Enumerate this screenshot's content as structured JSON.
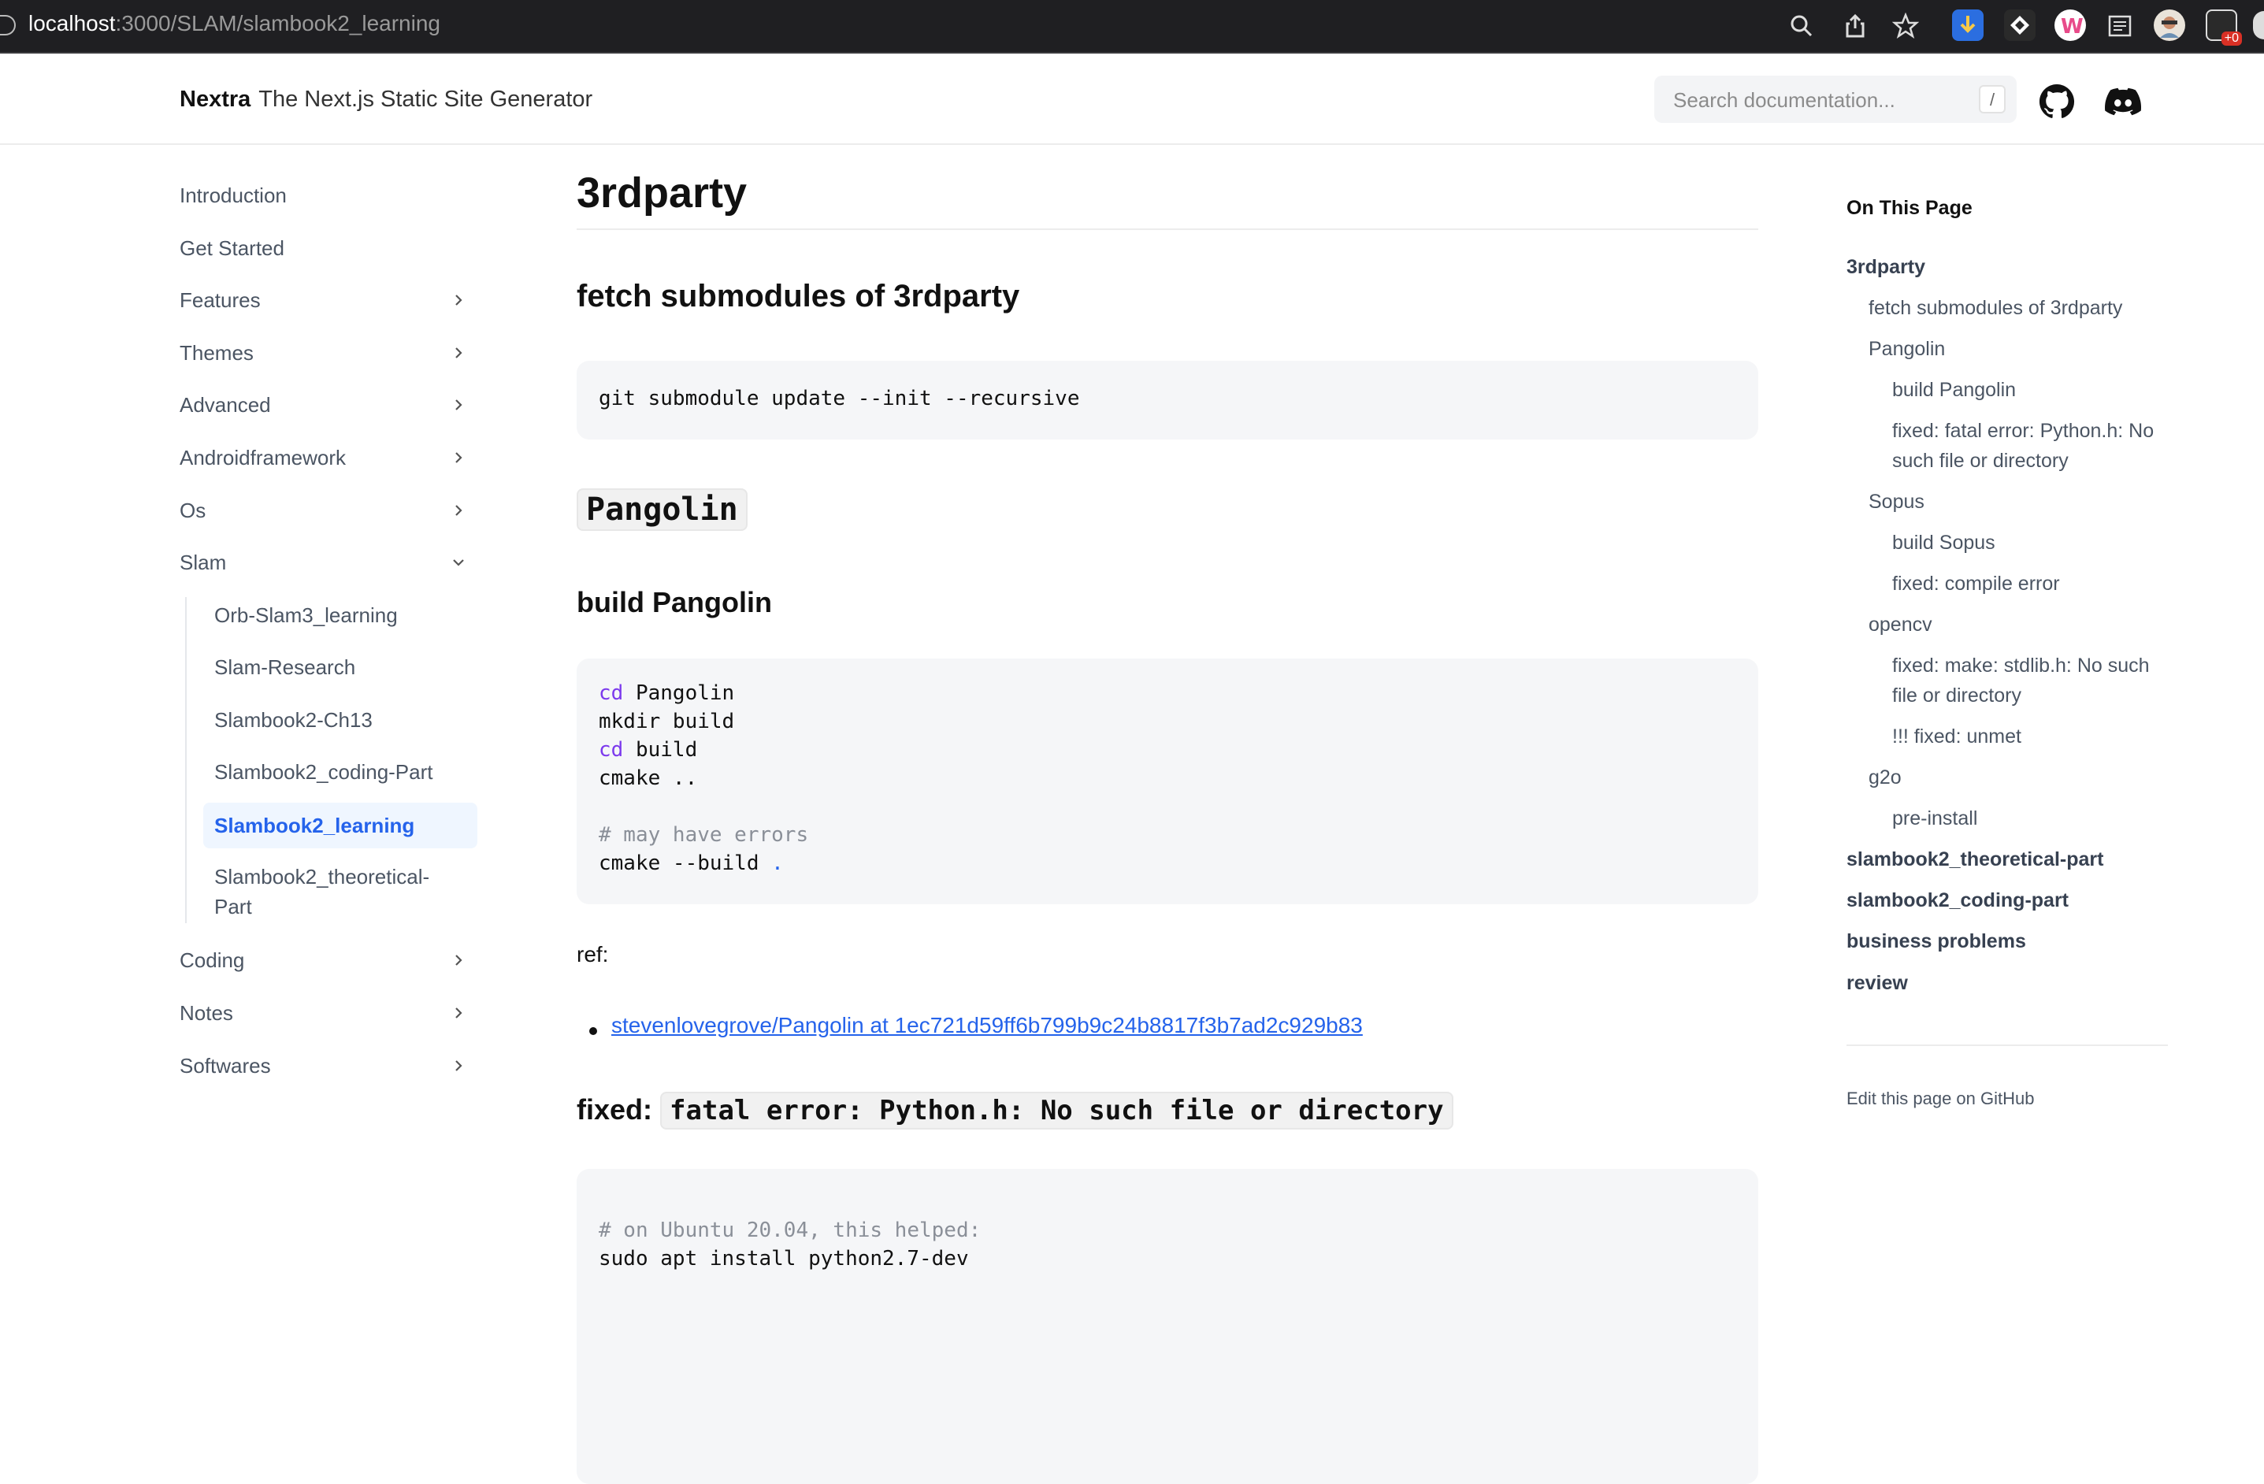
{
  "browser": {
    "url_host": "localhost",
    "url_path": ":3000/SLAM/slambook2_learning",
    "extension_badge": "+0"
  },
  "header": {
    "brand": "Nextra",
    "tagline": "The Next.js Static Site Generator",
    "search_placeholder": "Search documentation...",
    "search_shortcut": "/"
  },
  "sidebar": {
    "items": [
      {
        "label": "Introduction",
        "has_children": false
      },
      {
        "label": "Get Started",
        "has_children": false
      },
      {
        "label": "Features",
        "has_children": true
      },
      {
        "label": "Themes",
        "has_children": true
      },
      {
        "label": "Advanced",
        "has_children": true
      },
      {
        "label": "Androidframework",
        "has_children": true
      },
      {
        "label": "Os",
        "has_children": true
      },
      {
        "label": "Slam",
        "has_children": true,
        "expanded": true
      }
    ],
    "slam_children": [
      "Orb-Slam3_learning",
      "Slam-Research",
      "Slambook2-Ch13",
      "Slambook2_coding-Part",
      "Slambook2_learning",
      "Slambook2_theoretical-Part"
    ],
    "active_child": "Slambook2_learning",
    "after_items": [
      {
        "label": "Coding",
        "has_children": true
      },
      {
        "label": "Notes",
        "has_children": true
      },
      {
        "label": "Softwares",
        "has_children": true
      }
    ]
  },
  "main": {
    "title": "3rdparty",
    "section1_heading": "fetch submodules of 3rdparty",
    "code1": "git submodule update --init --recursive",
    "pangolin_heading": "Pangolin",
    "build_pangolin_heading": "build Pangolin",
    "code2": {
      "l1_kw": "cd",
      "l1_rest": " Pangolin",
      "l2": "mkdir build",
      "l3_kw": "cd",
      "l3_rest": " build",
      "l4": "cmake ..",
      "l6_comment": "# may have errors",
      "l7": "cmake --build ",
      "l7_dot": "."
    },
    "ref_label": "ref:",
    "ref_link": "stevenlovegrove/Pangolin at 1ec721d59ff6b799b9c24b8817f3b7ad2c929b83",
    "fixed_prefix": "fixed:",
    "fixed_code": "fatal error: Python.h: No such file or directory",
    "code3": {
      "comment": "# on Ubuntu 20.04, this helped:",
      "cmd": "sudo apt install python2.7-dev"
    }
  },
  "toc": {
    "title": "On This Page",
    "items": [
      {
        "label": "3rdparty",
        "level": 1
      },
      {
        "label": "fetch submodules of 3rdparty",
        "level": 2
      },
      {
        "label": "Pangolin",
        "level": 2
      },
      {
        "label": "build Pangolin",
        "level": 3
      },
      {
        "label": "fixed: fatal error: Python.h: No such file or directory",
        "level": 3
      },
      {
        "label": "Sopus",
        "level": 2
      },
      {
        "label": "build Sopus",
        "level": 3
      },
      {
        "label": "fixed: compile error",
        "level": 3
      },
      {
        "label": "opencv",
        "level": 2
      },
      {
        "label": "fixed: make: stdlib.h: No such file or directory",
        "level": 3
      },
      {
        "label": "!!! fixed: unmet",
        "level": 3
      },
      {
        "label": "g2o",
        "level": 2
      },
      {
        "label": "pre-install",
        "level": 3
      },
      {
        "label": "slambook2_theoretical-part",
        "level": 1
      },
      {
        "label": "slambook2_coding-part",
        "level": 1
      },
      {
        "label": "business problems",
        "level": 1
      },
      {
        "label": "review",
        "level": 1
      }
    ],
    "edit_link": "Edit this page on GitHub"
  },
  "colors": {
    "accent": "#2563eb",
    "active_bg": "#eff6ff",
    "code_bg": "#f5f6f8",
    "browser_bg": "#1f1f22"
  }
}
